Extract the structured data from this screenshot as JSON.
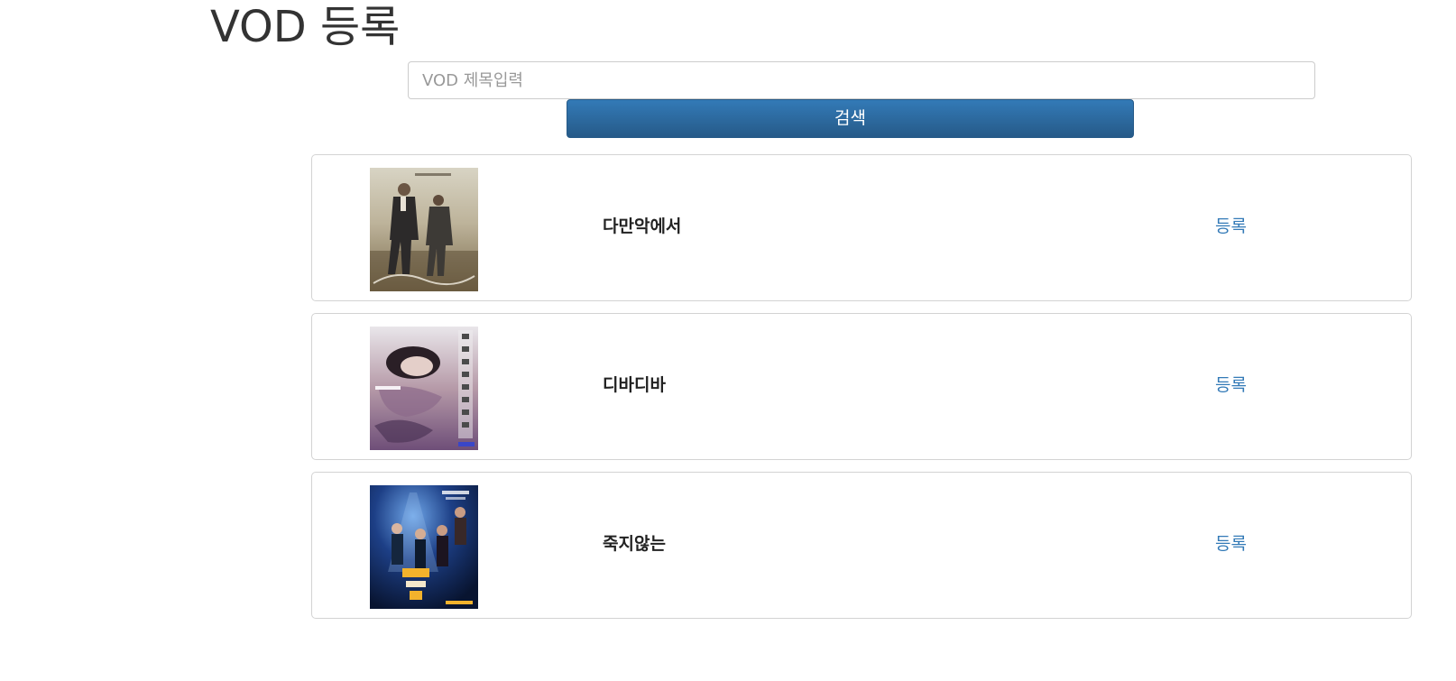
{
  "page": {
    "title": "VOD 등록"
  },
  "search": {
    "placeholder": "VOD 제목입력",
    "value": "",
    "button_label": "검색"
  },
  "vod_list": [
    {
      "title": "다만악에서",
      "action_label": "등록",
      "poster_text": "다만 악에서 구하소서"
    },
    {
      "title": "디바디바",
      "action_label": "등록",
      "poster_text": "디바"
    },
    {
      "title": "죽지않는",
      "action_label": "등록",
      "poster_text": "죽지않는 인간들의 밤"
    }
  ],
  "colors": {
    "accent": "#337ab7",
    "button_dark": "#265a88",
    "border": "#d3d3d3",
    "title_text": "#333333"
  }
}
